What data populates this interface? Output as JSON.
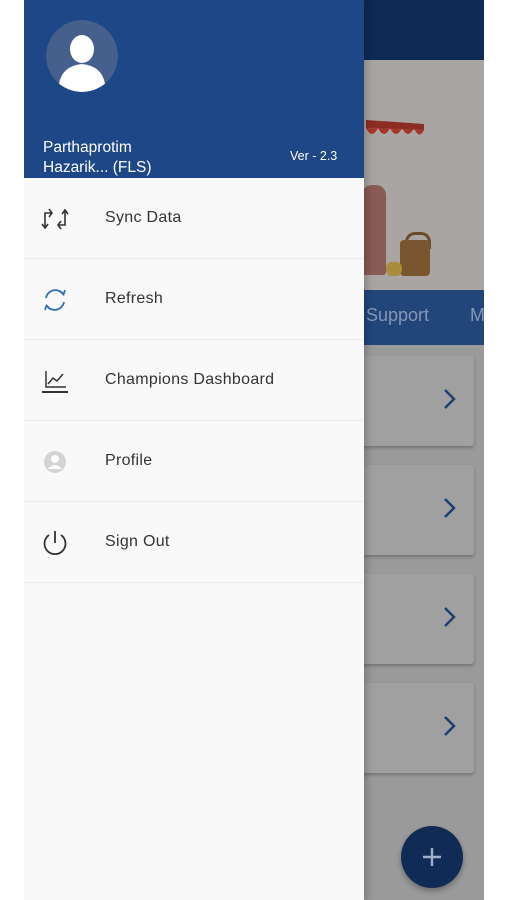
{
  "user": {
    "name_line1": "Parthaprotim",
    "name_line2": "Hazarik... (FLS)"
  },
  "app": {
    "version": "Ver - 2.3"
  },
  "menu": {
    "items": [
      {
        "label": "Sync Data",
        "icon": "sync-data-icon"
      },
      {
        "label": "Refresh",
        "icon": "refresh-icon"
      },
      {
        "label": "Champions Dashboard",
        "icon": "chart-line-icon"
      },
      {
        "label": "Profile",
        "icon": "profile-icon"
      },
      {
        "label": "Sign Out",
        "icon": "power-icon"
      }
    ]
  },
  "background": {
    "tabs": [
      {
        "label": "Support"
      },
      {
        "label": "M"
      }
    ]
  },
  "colors": {
    "drawer_header": "#1d4787",
    "app_bar": "#0e2a56",
    "tab_bar": "#22467a",
    "fab": "#102b56",
    "refresh_icon": "#2f6fb5"
  }
}
